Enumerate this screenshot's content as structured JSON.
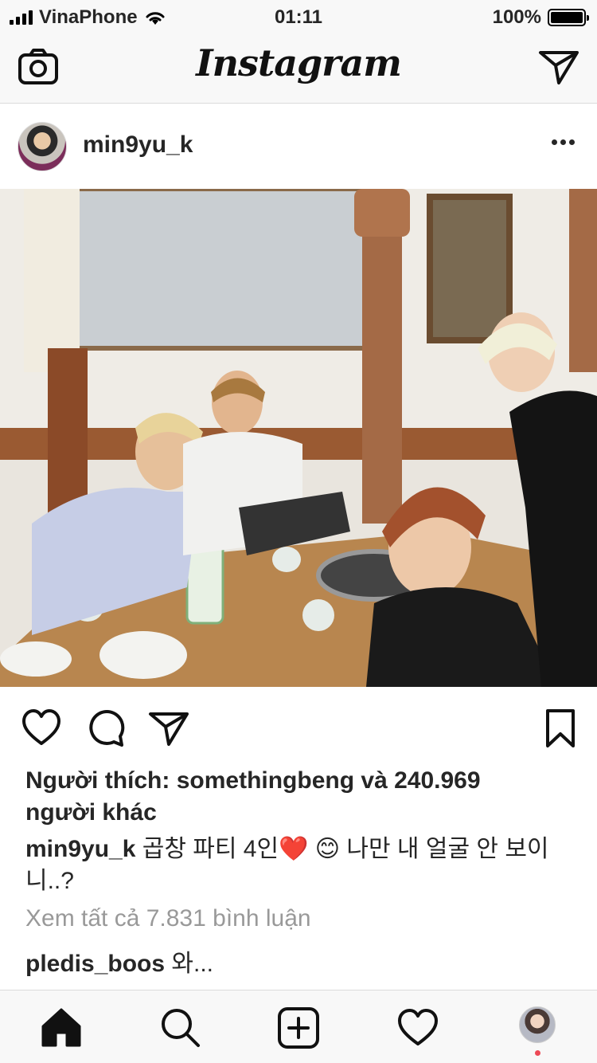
{
  "status_bar": {
    "carrier": "VinaPhone",
    "time": "01:11",
    "battery": "100%",
    "battery_level": 1.0
  },
  "top_nav": {
    "logo": "Instagram",
    "left_icon": "camera-icon",
    "right_icon": "direct-send-icon"
  },
  "post": {
    "username": "min9yu_k",
    "more_icon": "more-options-icon",
    "likes_prefix": "Người thích: ",
    "likes_user": "somethingbeng",
    "likes_mid": " và ",
    "likes_count": "240.969",
    "likes_suffix": " người khác",
    "caption_user": "min9yu_k",
    "caption_text": " 곱창 파티 4인❤️ 😊 나만 내 얼굴 안 보이니..?",
    "view_all_comments": "Xem tất cả 7.831 bình luận",
    "comment_user": "pledis_boos",
    "comment_text": " 와..."
  },
  "actions": {
    "like_icon": "heart-icon",
    "comment_icon": "comment-icon",
    "share_icon": "share-icon",
    "save_icon": "bookmark-icon"
  },
  "tab_bar": {
    "items": [
      "home-icon",
      "search-icon",
      "add-post-icon",
      "activity-icon",
      "profile-avatar"
    ]
  },
  "colors": {
    "accent_notification": "#ed4956",
    "text": "#262626",
    "muted": "#999999",
    "bar_bg": "#f8f8f8"
  }
}
